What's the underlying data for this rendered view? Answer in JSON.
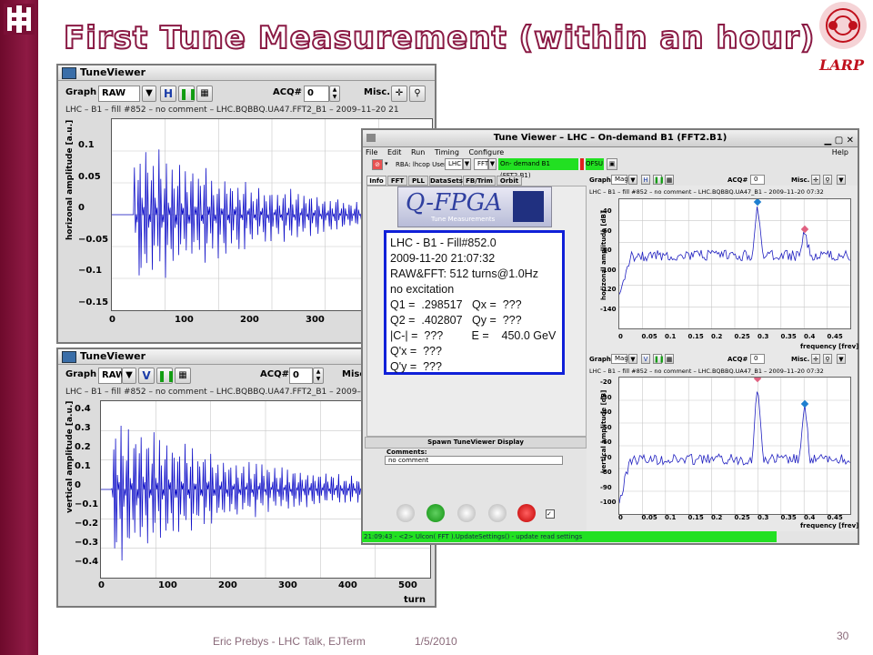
{
  "slide": {
    "title": "First Tune Measurement (within an hour)",
    "larp_label": "LARP",
    "footer_name": "Eric Prebys - LHC Talk, EJTerm",
    "footer_date": "1/5/2010",
    "page_number": "30",
    "accent_color": "#7a1036"
  },
  "top_viewer": {
    "window_title": "TuneViewer",
    "graph_label": "Graph",
    "mode_value": "RAW",
    "h_button": "H",
    "pause_icon": "pause-icon",
    "acq_label": "ACQ#",
    "acq_value": "0",
    "misc_label": "Misc.",
    "subtitle": "LHC – B1 – fill #852 – no comment – LHC.BQBBQ.UA47.FFT2_B1 – 2009–11–20 21",
    "ylabel": "horizonal amplitude [a.u.]",
    "yticks": [
      "0.1",
      "0.05",
      "0",
      "−0.05",
      "−0.1",
      "−0.15"
    ],
    "xticks": [
      "0",
      "100",
      "200",
      "300"
    ]
  },
  "bottom_viewer": {
    "window_title": "TuneViewer",
    "graph_label": "Graph",
    "mode_value": "RAW",
    "v_button": "V",
    "acq_label": "ACQ#",
    "acq_value": "0",
    "misc_label": "Misc",
    "subtitle": "LHC – B1 – fill #852 – no comment – LHC.BQBBQ.UA47.FFT2_B1 – 2009–",
    "ylabel": "vertical amplitude [a.u.]",
    "yticks": [
      "0.4",
      "0.3",
      "0.2",
      "0.1",
      "0",
      "−0.1",
      "−0.2",
      "−0.3",
      "−0.4"
    ],
    "xticks": [
      "0",
      "100",
      "200",
      "300",
      "400",
      "500"
    ],
    "xlabel": "turn"
  },
  "big_window": {
    "title": "Tune Viewer – LHC – On-demand B1 (FFT2.B1)",
    "menu": [
      "File",
      "Edit",
      "Run",
      "Timing",
      "Configure"
    ],
    "help": "Help",
    "rba_label": "RBA: lhcop User:",
    "user_value": "LHC",
    "mode_value": "FFT",
    "ondemand_label": "On- demand B1 (FFT2.B1)",
    "ofsu_label": "OFSU",
    "tabs": [
      "Info",
      "FFT",
      "PLL",
      "DataSets",
      "FB/Trim",
      "Orbit"
    ],
    "qfpga_logo": "Q-FPGA",
    "qfpga_sub": "Tune Measurements",
    "info_lines": [
      "LHC - B1 - Fill#852.0",
      "2009-11-20 21:07:32",
      "RAW&FFT: 512 turns@1.0Hz",
      "no excitation",
      "Q1 =  .298517   Qx =  ???",
      "Q2 =  .402807   Qy =  ???",
      "|C-| =  ???         E =    450.0 GeV",
      "Q'x =  ???",
      "Q'y =  ???"
    ],
    "spawn_label": "Spawn TuneViewer Display",
    "comments_label": "Comments:",
    "comments_value": "no comment",
    "status_text": "21:09:43 - <2> Ulcon( FFT ).UpdateSettings() - update read settings",
    "graph_label": "Graph",
    "mag_value": "Mag",
    "acq_label": "ACQ#",
    "acq_value": "0",
    "misc_label": "Misc.",
    "h_button": "H",
    "v_button": "V",
    "top_plot_subtitle": "LHC – B1 – fill #852 – no comment – LHC.BQBBQ.UA47_B1 – 2009–11–20 07:32",
    "bottom_plot_subtitle": "LHC – B1 – fill #852 – no comment – LHC.BQBBQ.UA47_B1 – 2009–11–20 07:32",
    "top_ylabel": "horizonal amplitude [dB]",
    "bottom_ylabel": "vertical amplitude [dB]",
    "freq_label": "frequency [frev]",
    "top_yticks": [
      "-40",
      "-60",
      "-80",
      "-100",
      "-120",
      "-140"
    ],
    "bottom_yticks": [
      "-20",
      "-30",
      "-40",
      "-50",
      "-60",
      "-70",
      "-80",
      "-90",
      "-100"
    ],
    "freq_ticks": [
      "0",
      "0.05",
      "0.1",
      "0.15",
      "0.2",
      "0.25",
      "0.3",
      "0.35",
      "0.4",
      "0.45"
    ]
  }
}
